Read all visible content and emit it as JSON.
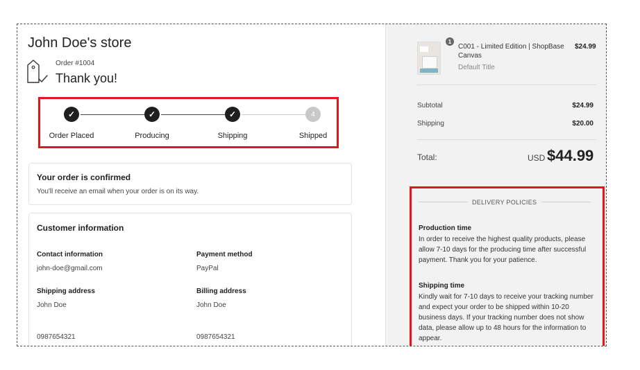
{
  "store": {
    "name": "John Doe's store"
  },
  "order": {
    "number": "Order #1004",
    "thanks": "Thank you!"
  },
  "progress": {
    "steps": [
      {
        "label": "Order Placed",
        "state": "done",
        "mark": "✓"
      },
      {
        "label": "Producing",
        "state": "done",
        "mark": "✓"
      },
      {
        "label": "Shipping",
        "state": "done",
        "mark": "✓"
      },
      {
        "label": "Shipped",
        "state": "pending",
        "mark": "4"
      }
    ]
  },
  "confirmation": {
    "title": "Your order is confirmed",
    "text": "You'll receive an email when your order is on its way."
  },
  "customer": {
    "title": "Customer information",
    "contact_label": "Contact information",
    "contact_value": "john-doe@gmail.com",
    "payment_label": "Payment method",
    "payment_value": "PayPal",
    "shipping_label": "Shipping address",
    "shipping_name": "John Doe",
    "shipping_phone": "0987654321",
    "billing_label": "Billing address",
    "billing_name": "John Doe",
    "billing_phone": "0987654321"
  },
  "product": {
    "quantity": "1",
    "name": "C001 - Limited Edition | ShopBase Canvas",
    "variant": "Default Title",
    "price": "$24.99"
  },
  "summary": {
    "subtotal_label": "Subtotal",
    "subtotal_value": "$24.99",
    "shipping_label": "Shipping",
    "shipping_value": "$20.00",
    "total_label": "Total:",
    "currency": "USD",
    "total_value": "$44.99"
  },
  "policies": {
    "heading": "DELIVERY POLICIES",
    "production_title": "Production time",
    "production_text": "In order to receive the highest quality products, please allow 7-10 days for the producing time after successful payment. Thank you for your patience.",
    "shipping_title": "Shipping time",
    "shipping_text": "Kindly wait for 7-10 days to receive your tracking number and expect your order to be shipped within 10-20 business days. If your tracking number does not show data, please allow up to 48 hours for the information to appear."
  },
  "colors": {
    "highlight": "#e8141b",
    "step_done": "#1f1f1f",
    "step_pending": "#c8c8c8"
  }
}
